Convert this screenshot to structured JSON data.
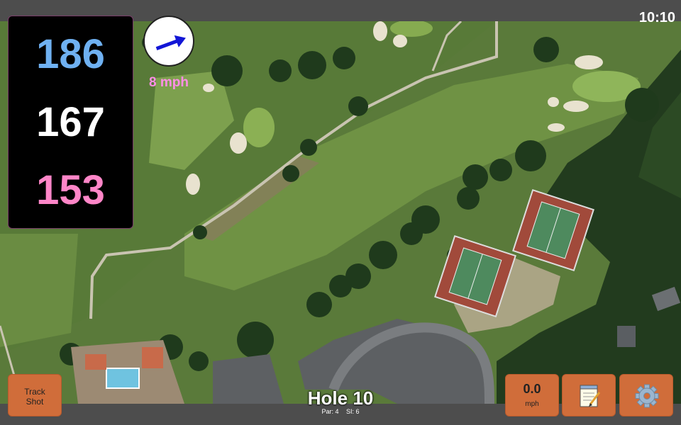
{
  "clock": "10:10",
  "yardages": {
    "back": "186",
    "middle": "167",
    "front": "153"
  },
  "wind": {
    "speed_label": "8 mph",
    "icon": "wind-direction-arrow-icon",
    "direction_deg": 20
  },
  "buttons": {
    "track_shot_line1": "Track",
    "track_shot_line2": "Shot",
    "speed_value": "0.0",
    "speed_unit": "mph",
    "notes_icon": "notepad-icon",
    "settings_icon": "gear-icon"
  },
  "hole": {
    "title": "Hole 10",
    "par_label": "Par: 4",
    "si_label": "SI: 6"
  },
  "colors": {
    "back_yardage": "#6fb1f2",
    "middle_yardage": "#ffffff",
    "front_yardage": "#ff86c8",
    "button": "#d06d3a",
    "wind_label": "#ff8ee6"
  }
}
